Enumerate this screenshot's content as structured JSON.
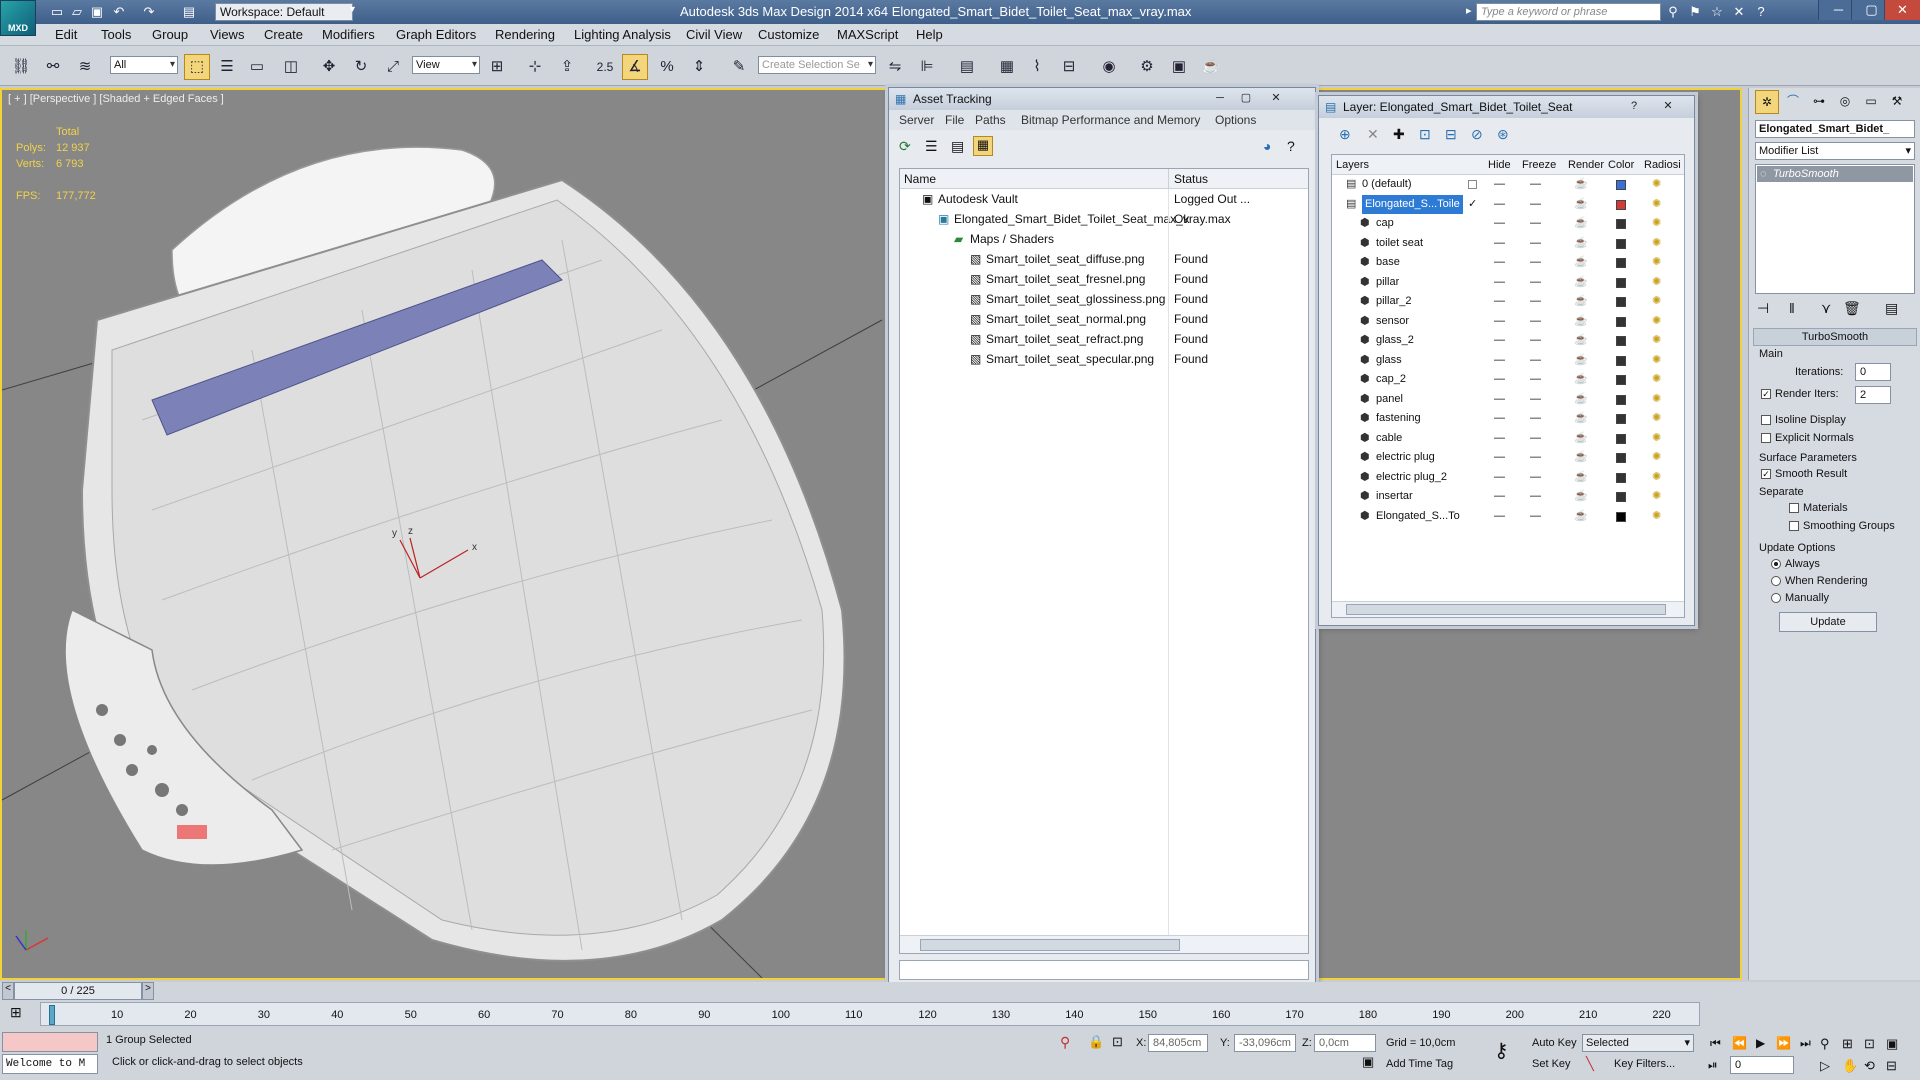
{
  "titlebar": {
    "logo": "MXD",
    "workspace": "Workspace: Default",
    "app_title": "Autodesk 3ds Max Design 2014 x64      Elongated_Smart_Bidet_Toilet_Seat_max_vray.max",
    "search_placeholder": "Type a keyword or phrase"
  },
  "menu": [
    "Edit",
    "Tools",
    "Group",
    "Views",
    "Create",
    "Modifiers",
    "Graph Editors",
    "Rendering",
    "Lighting Analysis",
    "Civil View",
    "Customize",
    "MAXScript",
    "Help"
  ],
  "toolbar": {
    "selection_filter": "All",
    "ref_coord": "View",
    "snap_value": "2.5",
    "named_selection_placeholder": "Create Selection Se"
  },
  "viewport": {
    "label": "[ + ] [Perspective ] [Shaded + Edged Faces ]",
    "stats": {
      "total_label": "Total",
      "polys_label": "Polys:",
      "polys": "12 937",
      "verts_label": "Verts:",
      "verts": "6 793",
      "fps_label": "FPS:",
      "fps": "177,772"
    },
    "gizmo": {
      "x": "x",
      "y": "y",
      "z": "z"
    }
  },
  "asset_tracking": {
    "title": "Asset Tracking",
    "menu": [
      "Server",
      "File",
      "Paths",
      "Bitmap Performance and Memory",
      "Options"
    ],
    "columns": [
      "Name",
      "Status"
    ],
    "rows": [
      {
        "name": "Autodesk Vault",
        "status": "Logged Out ..."
      },
      {
        "name": "Elongated_Smart_Bidet_Toilet_Seat_max_vray.max",
        "status": "Ok"
      },
      {
        "name": "Maps / Shaders",
        "status": ""
      },
      {
        "name": "Smart_toilet_seat_diffuse.png",
        "status": "Found"
      },
      {
        "name": "Smart_toilet_seat_fresnel.png",
        "status": "Found"
      },
      {
        "name": "Smart_toilet_seat_glossiness.png",
        "status": "Found"
      },
      {
        "name": "Smart_toilet_seat_normal.png",
        "status": "Found"
      },
      {
        "name": "Smart_toilet_seat_refract.png",
        "status": "Found"
      },
      {
        "name": "Smart_toilet_seat_specular.png",
        "status": "Found"
      }
    ]
  },
  "layer_dialog": {
    "title": "Layer: Elongated_Smart_Bidet_Toilet_Seat",
    "help": "?",
    "columns": [
      "Layers",
      "Hide",
      "Freeze",
      "Render",
      "Color",
      "Radiosi"
    ],
    "rows": [
      {
        "name": "0 (default)",
        "color": "#3a6fd8"
      },
      {
        "name": "Elongated_S...Toile",
        "color": "#d23a3a"
      },
      {
        "name": "cap",
        "color": "#333333"
      },
      {
        "name": "toilet seat",
        "color": "#333333"
      },
      {
        "name": "base",
        "color": "#333333"
      },
      {
        "name": "pillar",
        "color": "#333333"
      },
      {
        "name": "pillar_2",
        "color": "#333333"
      },
      {
        "name": "sensor",
        "color": "#333333"
      },
      {
        "name": "glass_2",
        "color": "#333333"
      },
      {
        "name": "glass",
        "color": "#333333"
      },
      {
        "name": "cap_2",
        "color": "#333333"
      },
      {
        "name": "panel",
        "color": "#333333"
      },
      {
        "name": "fastening",
        "color": "#333333"
      },
      {
        "name": "cable",
        "color": "#333333"
      },
      {
        "name": "electric plug",
        "color": "#333333"
      },
      {
        "name": "electric plug_2",
        "color": "#333333"
      },
      {
        "name": "insertar",
        "color": "#333333"
      },
      {
        "name": "Elongated_S...To",
        "color": "#000000"
      }
    ]
  },
  "command_panel": {
    "object_name": "Elongated_Smart_Bidet_",
    "modifier_list": "Modifier List",
    "stack_item": "TurboSmooth",
    "rollout_title": "TurboSmooth",
    "main_group": "Main",
    "iterations_label": "Iterations:",
    "iterations": "0",
    "render_iters_label": "Render Iters:",
    "render_iters": "2",
    "isoline": "Isoline Display",
    "explicit_normals": "Explicit Normals",
    "surface_group": "Surface Parameters",
    "smooth_result": "Smooth Result",
    "separate": "Separate",
    "materials": "Materials",
    "smoothing_groups": "Smoothing Groups",
    "update_group": "Update Options",
    "always": "Always",
    "when_rendering": "When Rendering",
    "manually": "Manually",
    "update_button": "Update"
  },
  "timeline": {
    "frame_counter": "0 / 225",
    "ticks": [
      "10",
      "20",
      "30",
      "40",
      "50",
      "60",
      "70",
      "80",
      "90",
      "100",
      "110",
      "120",
      "130",
      "140",
      "150",
      "160",
      "170",
      "180",
      "190",
      "200",
      "210",
      "220"
    ]
  },
  "statusbar": {
    "maxscript": "Welcome to M",
    "selection": "1 Group Selected",
    "prompt": "Click or click-and-drag to select objects",
    "x_label": "X:",
    "x_value": "84,805cm",
    "y_label": "Y:",
    "y_value": "-33,096cm",
    "z_label": "Z:",
    "z_value": "0,0cm",
    "grid": "Grid = 10,0cm",
    "add_time_tag": "Add Time Tag",
    "auto_key": "Auto Key",
    "selected": "Selected",
    "set_key": "Set Key",
    "key_filters": "Key Filters...",
    "frame": "0"
  }
}
